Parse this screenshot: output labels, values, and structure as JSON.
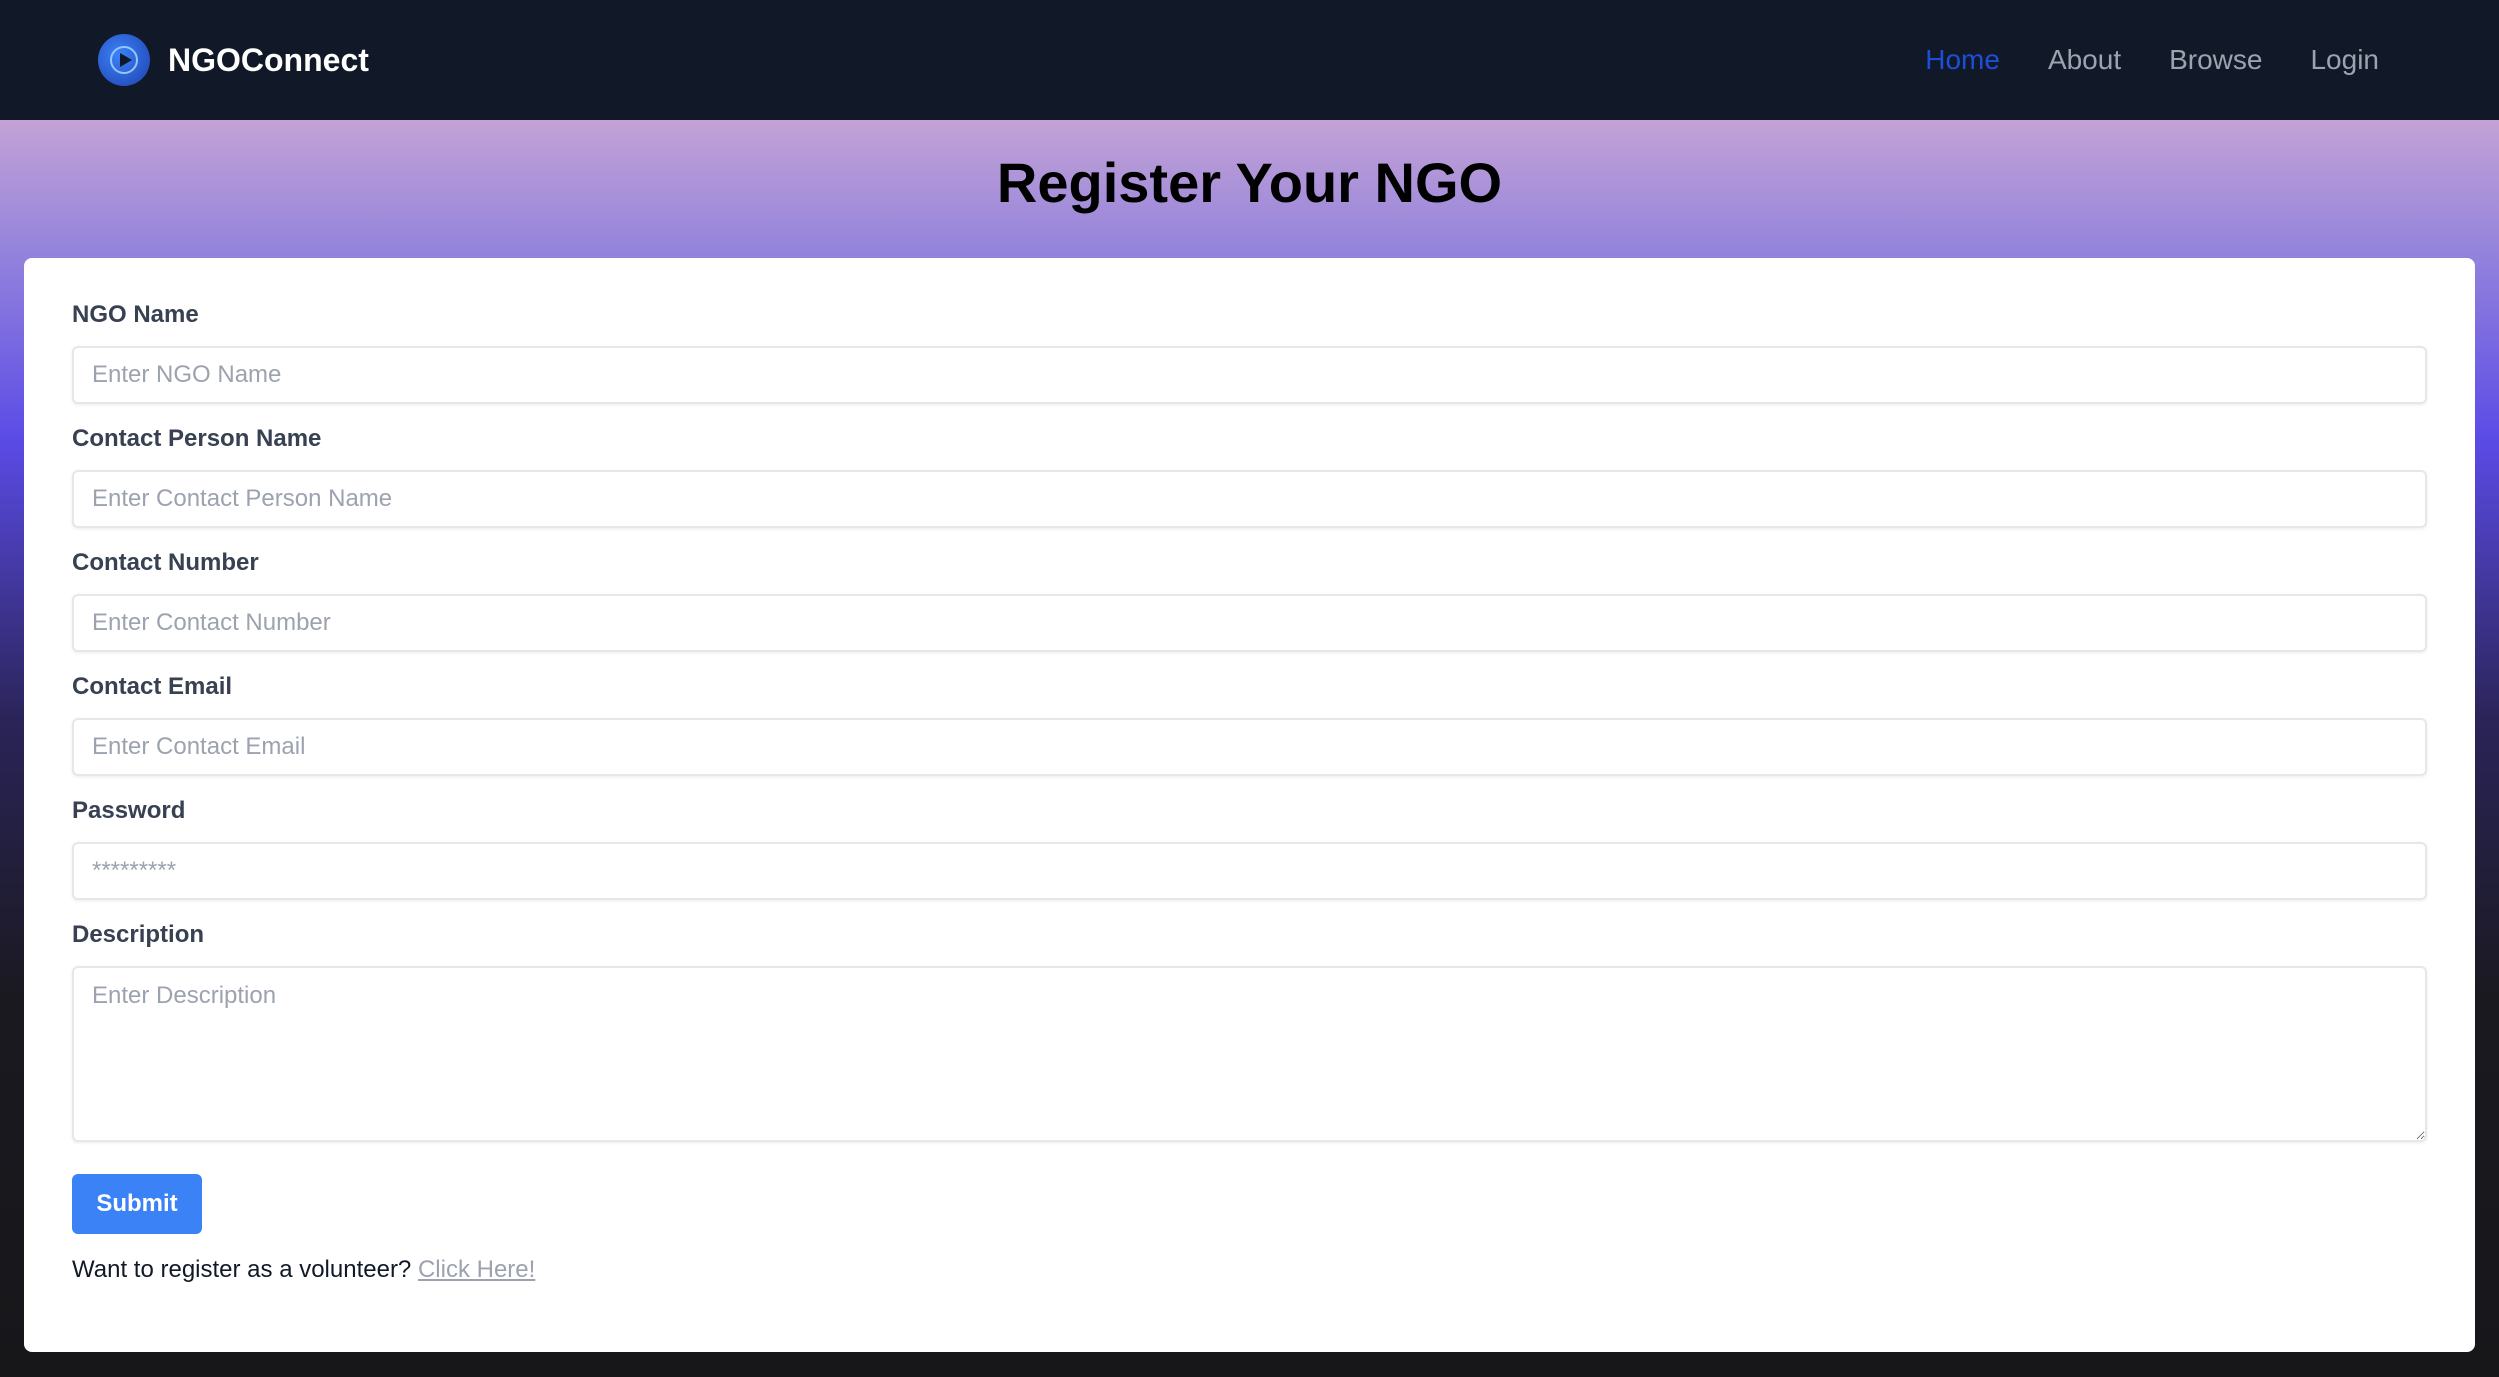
{
  "navbar": {
    "brand": "NGOConnect",
    "links": [
      {
        "label": "Home",
        "active": true
      },
      {
        "label": "About",
        "active": false
      },
      {
        "label": "Browse",
        "active": false
      },
      {
        "label": "Login",
        "active": false
      }
    ]
  },
  "page": {
    "title": "Register Your NGO"
  },
  "form": {
    "ngo_name": {
      "label": "NGO Name",
      "placeholder": "Enter NGO Name"
    },
    "contact_person": {
      "label": "Contact Person Name",
      "placeholder": "Enter Contact Person Name"
    },
    "contact_number": {
      "label": "Contact Number",
      "placeholder": "Enter Contact Number"
    },
    "contact_email": {
      "label": "Contact Email",
      "placeholder": "Enter Contact Email"
    },
    "password": {
      "label": "Password",
      "placeholder": "*********"
    },
    "description": {
      "label": "Description",
      "placeholder": "Enter Description"
    },
    "submit_label": "Submit",
    "footer_text": "Want to register as a volunteer?",
    "footer_link": "Click Here!"
  },
  "colors": {
    "accent": "#3b82f6",
    "nav_active": "#1d4ed8",
    "nav_bg": "#111827"
  },
  "icons": {
    "brand_logo": "play-circle-icon"
  }
}
